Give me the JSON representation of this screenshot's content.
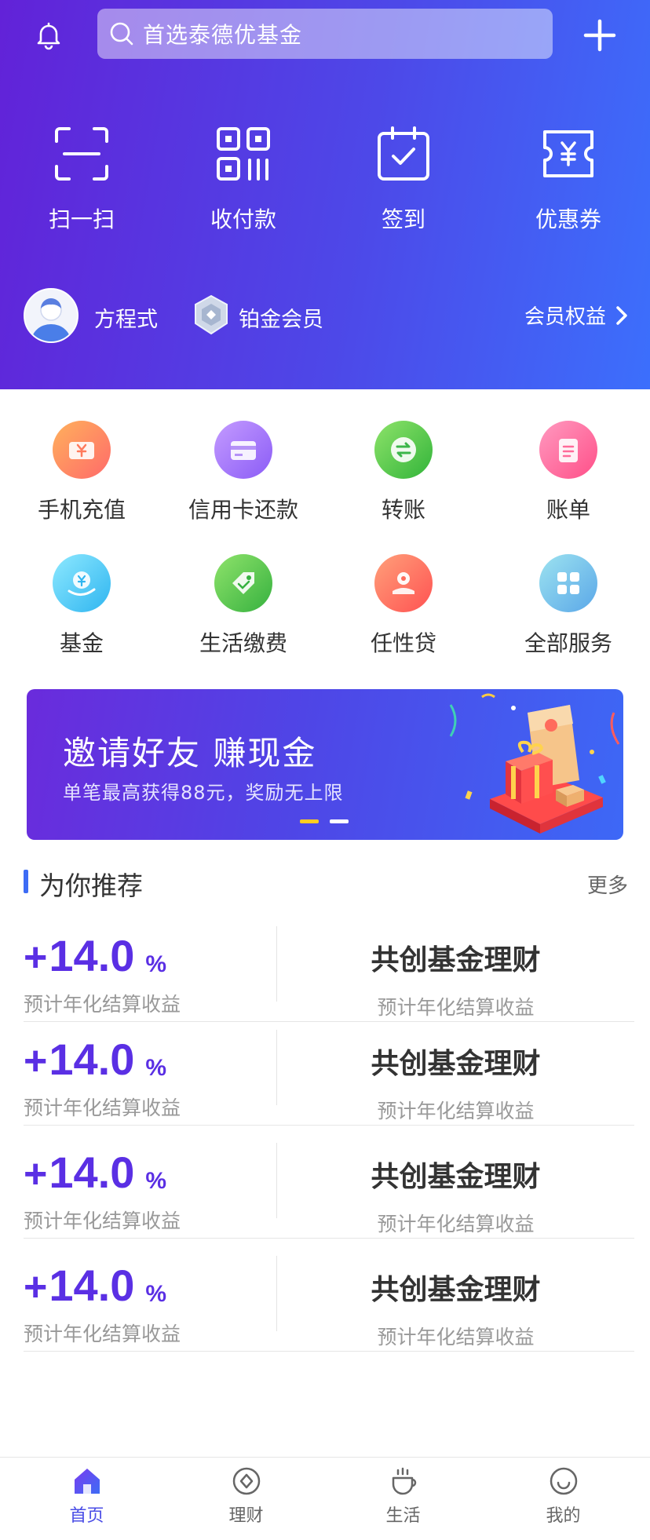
{
  "header": {
    "search_placeholder": "首选泰德优基金",
    "quick_actions": [
      {
        "label": "扫一扫",
        "icon": "scan-icon"
      },
      {
        "label": "收付款",
        "icon": "qr-code-icon"
      },
      {
        "label": "签到",
        "icon": "calendar-check-icon"
      },
      {
        "label": "优惠券",
        "icon": "coupon-icon"
      }
    ],
    "member": {
      "username": "方程式",
      "level": "铂金会员",
      "rights_link": "会员权益"
    }
  },
  "services": [
    {
      "label": "手机充值",
      "icon": "phone-recharge-icon",
      "color_from": "#ffb15c",
      "color_to": "#ff6a6a"
    },
    {
      "label": "信用卡还款",
      "icon": "credit-card-icon",
      "color_from": "#c49bff",
      "color_to": "#8b5cf6"
    },
    {
      "label": "转账",
      "icon": "transfer-icon",
      "color_from": "#8ee36a",
      "color_to": "#32b43a"
    },
    {
      "label": "账单",
      "icon": "bill-icon",
      "color_from": "#ff9ac0",
      "color_to": "#ff4f88"
    },
    {
      "label": "基金",
      "icon": "fund-icon",
      "color_from": "#8ee9ff",
      "color_to": "#2fb5f0"
    },
    {
      "label": "生活缴费",
      "icon": "tag-icon",
      "color_from": "#8fe36b",
      "color_to": "#36b13f"
    },
    {
      "label": "任性贷",
      "icon": "loan-icon",
      "color_from": "#ffa07a",
      "color_to": "#ff5252"
    },
    {
      "label": "全部服务",
      "icon": "all-services-icon",
      "color_from": "#9de3f0",
      "color_to": "#5aa7e8"
    }
  ],
  "banner": {
    "title": "邀请好友 赚现金",
    "subtitle": "单笔最高获得88元，奖励无上限"
  },
  "recommend": {
    "title": "为你推荐",
    "more": "更多",
    "items": [
      {
        "sign": "+",
        "rate": "14.0",
        "unit": "%",
        "rate_caption": "预计年化结算收益",
        "name": "共创基金理财",
        "name_caption": "预计年化结算收益"
      },
      {
        "sign": "+",
        "rate": "14.0",
        "unit": "%",
        "rate_caption": "预计年化结算收益",
        "name": "共创基金理财",
        "name_caption": "预计年化结算收益"
      },
      {
        "sign": "+",
        "rate": "14.0",
        "unit": "%",
        "rate_caption": "预计年化结算收益",
        "name": "共创基金理财",
        "name_caption": "预计年化结算收益"
      },
      {
        "sign": "+",
        "rate": "14.0",
        "unit": "%",
        "rate_caption": "预计年化结算收益",
        "name": "共创基金理财",
        "name_caption": "预计年化结算收益"
      }
    ]
  },
  "tabbar": [
    {
      "label": "首页",
      "icon": "home-icon",
      "active": true
    },
    {
      "label": "理财",
      "icon": "wealth-icon",
      "active": false
    },
    {
      "label": "生活",
      "icon": "life-cup-icon",
      "active": false
    },
    {
      "label": "我的",
      "icon": "profile-smile-icon",
      "active": false
    }
  ],
  "colors": {
    "header_from": "#6222d8",
    "header_to": "#3c6ffc",
    "rate_purple": "#5a2fe4",
    "accent_blue": "#3d6cf5",
    "active_tab": "#4a4de6",
    "banner_dot_active": "#ffcc1f"
  }
}
